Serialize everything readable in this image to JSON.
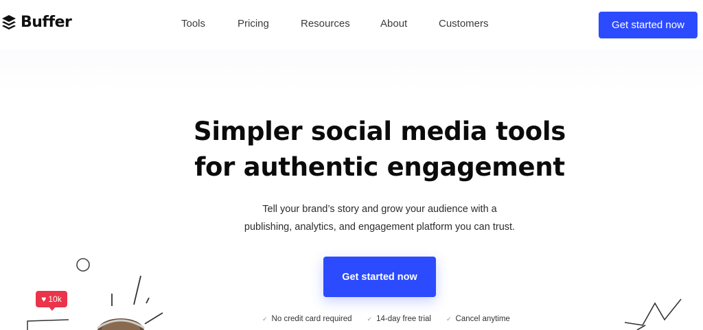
{
  "header": {
    "logo_text": "Buffer",
    "nav": {
      "tools": "Tools",
      "pricing": "Pricing",
      "resources": "Resources",
      "about": "About",
      "customers": "Customers"
    },
    "cta_label": "Get started now"
  },
  "hero": {
    "title_line1": "Simpler social media tools",
    "title_line2": "for authentic engagement",
    "subtitle_line1": "Tell your brand’s story and grow your audience with a",
    "subtitle_line2": "publishing, analytics, and engagement platform you can trust.",
    "cta_label": "Get started now",
    "perks": [
      "No credit card required",
      "14-day free trial",
      "Cancel anytime"
    ]
  },
  "decor": {
    "like_count": "10k",
    "accent_color": "#2c4bff",
    "like_color": "#e9344a"
  }
}
